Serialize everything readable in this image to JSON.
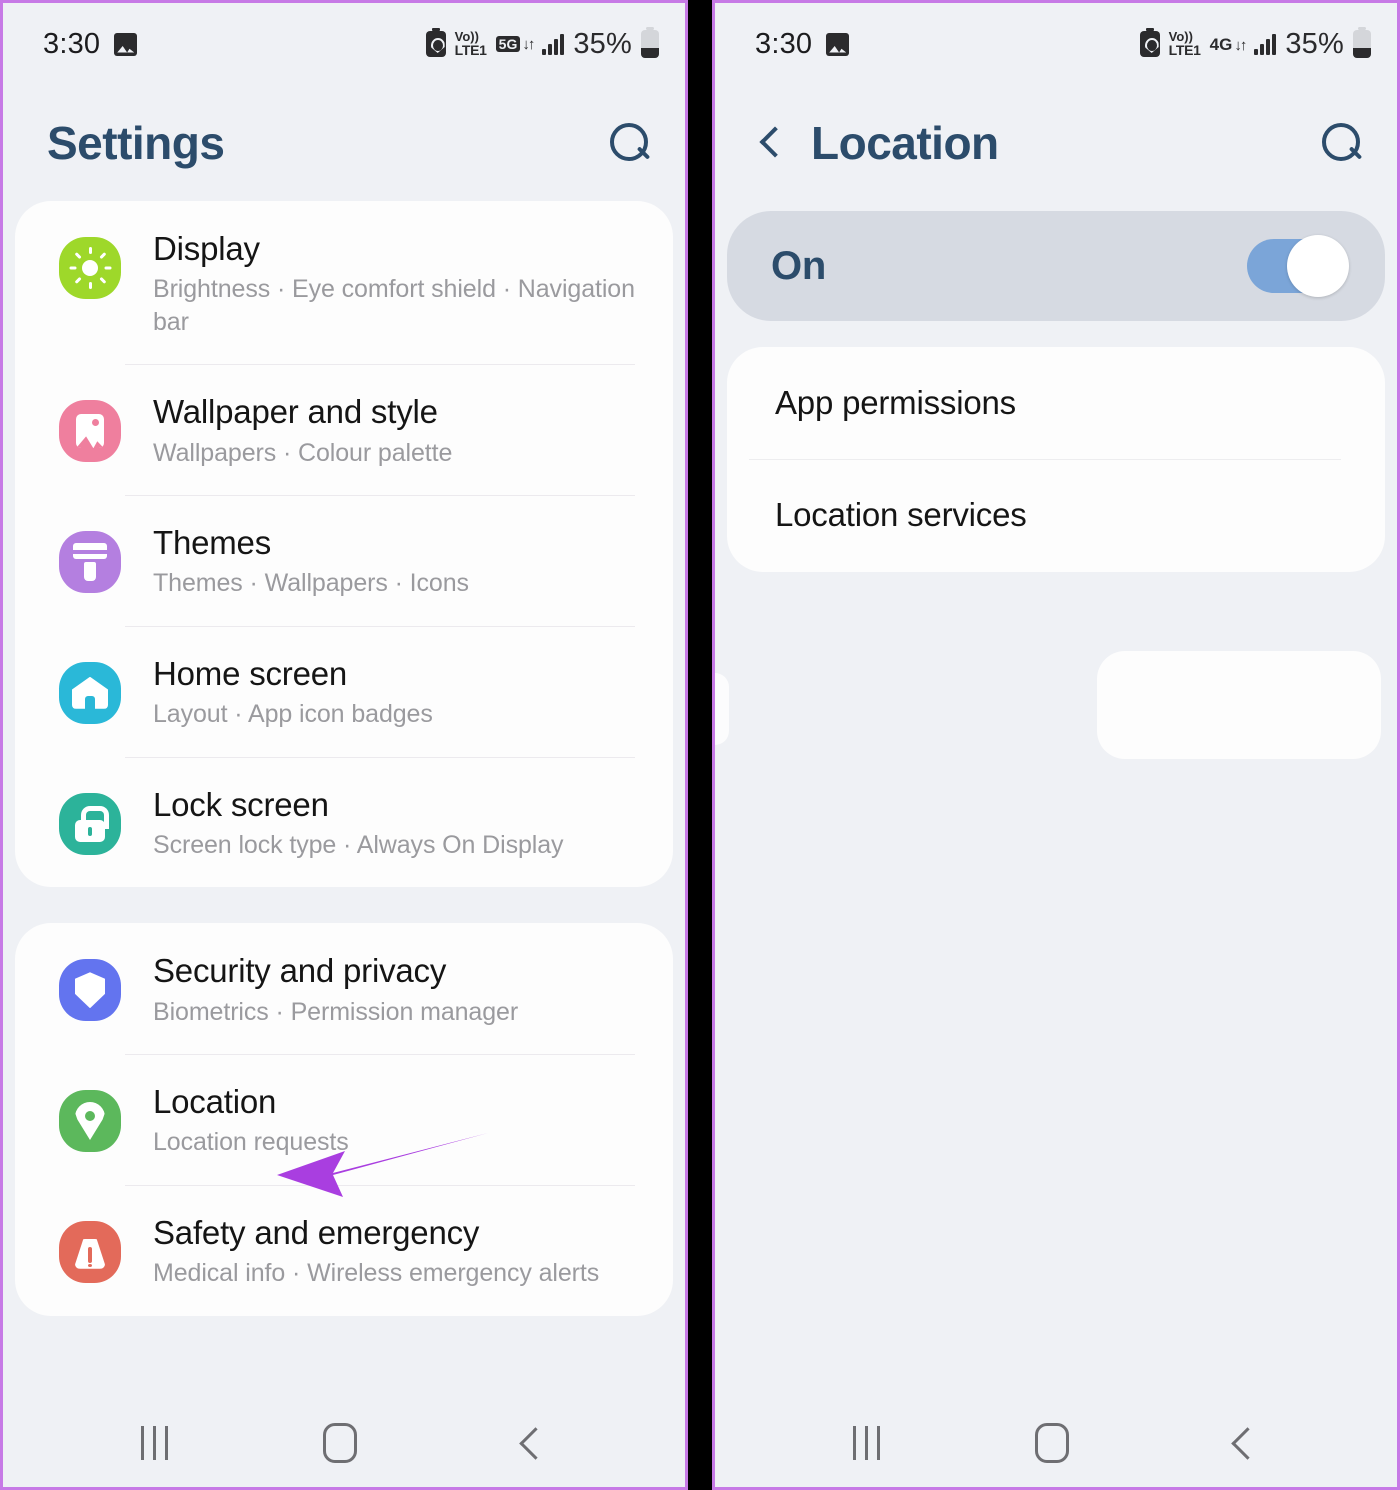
{
  "theme": {
    "accent_title": "#2c4c6b",
    "arrow_color": "#a93ee0",
    "panel_border": "#c77ae6",
    "page_bg": "#eff1f5",
    "card_bg": "#fdfdfd",
    "toggle_track": "#7ba5d8",
    "pill_bg": "#d6dae2"
  },
  "left_phone": {
    "status_bar": {
      "time": "3:30",
      "screenshot_icon": "image-icon",
      "battery_saver_icon": "battery-recycle-icon",
      "volte_line1": "Vo))",
      "volte_line2": "LTE1",
      "network_type": "5G",
      "network_badge_style": "boxed",
      "data_arrows": "↓↑",
      "signal_icon": "signal-bars-icon",
      "battery_percent": "35%",
      "battery_icon": "battery-icon"
    },
    "header": {
      "title": "Settings",
      "search_icon": "search-icon"
    },
    "cards": [
      {
        "rows": [
          {
            "icon": "brightness-sun-icon",
            "icon_color": "#9ed82a",
            "title": "Display",
            "subtitle": "Brightness  ·  Eye comfort shield  ·  Navigation bar"
          },
          {
            "icon": "wallpaper-image-icon",
            "icon_color": "#ef7f9e",
            "title": "Wallpaper and style",
            "subtitle": "Wallpapers  ·  Colour palette"
          },
          {
            "icon": "themes-brush-icon",
            "icon_color": "#b47fe0",
            "title": "Themes",
            "subtitle": "Themes  ·  Wallpapers  ·  Icons"
          },
          {
            "icon": "home-icon",
            "icon_color": "#2ab8d8",
            "title": "Home screen",
            "subtitle": "Layout  ·  App icon badges"
          },
          {
            "icon": "lock-icon",
            "icon_color": "#2cb39a",
            "title": "Lock screen",
            "subtitle": "Screen lock type  ·  Always On Display"
          }
        ]
      },
      {
        "rows": [
          {
            "icon": "shield-icon",
            "icon_color": "#6374ef",
            "title": "Security and privacy",
            "subtitle": "Biometrics  ·  Permission manager"
          },
          {
            "icon": "location-pin-icon",
            "icon_color": "#5cb85c",
            "title": "Location",
            "subtitle": "Location requests"
          },
          {
            "icon": "emergency-alert-icon",
            "icon_color": "#e36a5a",
            "title": "Safety and emergency",
            "subtitle": "Medical info  ·  Wireless emergency alerts"
          }
        ]
      }
    ],
    "annotation": {
      "target": "Location",
      "type": "arrow"
    },
    "nav_bar": {
      "recents_icon": "recents-icon",
      "home_icon": "home-nav-icon",
      "back_icon": "back-nav-icon"
    }
  },
  "right_phone": {
    "status_bar": {
      "time": "3:30",
      "screenshot_icon": "image-icon",
      "battery_saver_icon": "battery-recycle-icon",
      "volte_line1": "Vo))",
      "volte_line2": "LTE1",
      "network_type": "4G",
      "network_badge_style": "plain",
      "data_arrows": "↓↑",
      "signal_icon": "signal-bars-icon",
      "battery_percent": "35%",
      "battery_icon": "battery-icon"
    },
    "header": {
      "back_icon": "back-chevron-icon",
      "title": "Location",
      "search_icon": "search-icon"
    },
    "master_toggle": {
      "label": "On",
      "state": "on"
    },
    "options": [
      {
        "title": "App permissions"
      },
      {
        "title": "Location services"
      }
    ],
    "annotation": {
      "target": "App permissions",
      "type": "arrow"
    },
    "nav_bar": {
      "recents_icon": "recents-icon",
      "home_icon": "home-nav-icon",
      "back_icon": "back-nav-icon"
    }
  }
}
